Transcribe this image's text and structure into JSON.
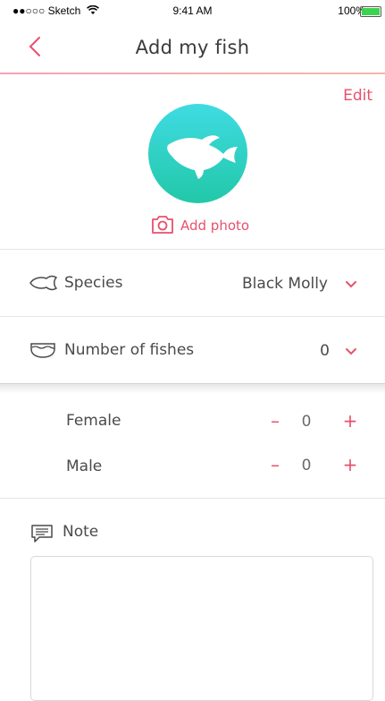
{
  "status_bar": {
    "carrier": "●●○○○ Sketch",
    "time": "9:41 AM",
    "battery": "100%"
  },
  "header": {
    "title": "Add my fish",
    "back_icon": "chevron-left-icon",
    "edit_label": "Edit"
  },
  "photo": {
    "add_label": "Add photo",
    "avatar_color_top": "#3fdbe3",
    "avatar_color_bottom": "#22c8a8"
  },
  "species": {
    "label": "Species",
    "value": "Black Molly"
  },
  "fish_count": {
    "label": "Number of fishes",
    "value": "0"
  },
  "genders": [
    {
      "label": "Female",
      "value": "0",
      "minus": "–",
      "plus": "+"
    },
    {
      "label": "Male",
      "value": "0",
      "minus": "–",
      "plus": "+"
    }
  ],
  "note": {
    "label": "Note",
    "value": ""
  },
  "colors": {
    "accent": "#e8506b",
    "text": "#4a4a4a"
  }
}
